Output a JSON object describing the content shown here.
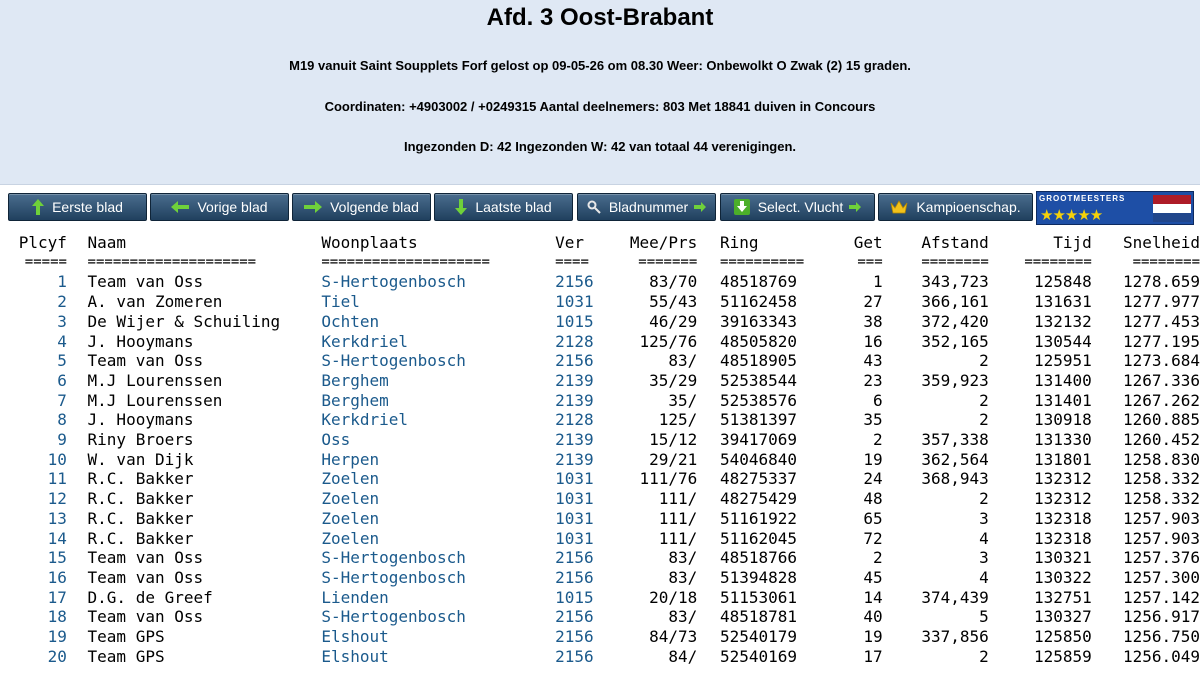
{
  "header": {
    "title": "Afd. 3 Oost-Brabant",
    "line1": "M19 vanuit Saint Soupplets Forf gelost op 09-05-26 om 08.30 Weer: Onbewolkt O Zwak (2) 15 graden.",
    "line2": "Coordinaten: +4903002 / +0249315 Aantal deelnemers: 803 Met 18841 duiven in Concours",
    "line3": "Ingezonden D: 42 Ingezonden W: 42 van totaal 44 verenigingen."
  },
  "toolbar": {
    "first": "Eerste blad",
    "prev": "Vorige blad",
    "next": "Volgende blad",
    "last": "Laatste blad",
    "page_number": "Bladnummer",
    "select_flight": "Select. Vlucht",
    "championship": "Kampioenschap.",
    "logo_text": "GROOTMEESTERS",
    "logo_stars": "★★★★★"
  },
  "colors": {
    "header_bg": "#dfe8f4",
    "button_bg": "#2f5272",
    "link_blue": "#1b5a8c",
    "flag_red": "#ae1c28",
    "flag_white": "#ffffff",
    "flag_blue": "#21468b"
  },
  "table": {
    "headers": [
      "Plcyf",
      "Naam",
      "Woonplaats",
      "Ver",
      "Mee/Prs",
      "Ring",
      "Get",
      "Afstand",
      "Tijd",
      "Snelheid"
    ],
    "separators": [
      "=====",
      "====================",
      "====================",
      "====",
      "=======",
      "==========",
      "===",
      "========",
      "========",
      "========"
    ],
    "rows": [
      [
        "1",
        "Team van Oss",
        "S-Hertogenbosch",
        "2156",
        "83/70",
        "48518769",
        "1",
        "343,723",
        "125848",
        "1278.659"
      ],
      [
        "2",
        "A. van Zomeren",
        "Tiel",
        "1031",
        "55/43",
        "51162458",
        "27",
        "366,161",
        "131631",
        "1277.977"
      ],
      [
        "3",
        "De Wijer & Schuiling",
        "Ochten",
        "1015",
        "46/29",
        "39163343",
        "38",
        "372,420",
        "132132",
        "1277.453"
      ],
      [
        "4",
        "J. Hooymans",
        "Kerkdriel",
        "2128",
        "125/76",
        "48505820",
        "16",
        "352,165",
        "130544",
        "1277.195"
      ],
      [
        "5",
        "Team van Oss",
        "S-Hertogenbosch",
        "2156",
        "83/",
        "48518905",
        "43",
        "2",
        "125951",
        "1273.684"
      ],
      [
        "6",
        "M.J Lourenssen",
        "Berghem",
        "2139",
        "35/29",
        "52538544",
        "23",
        "359,923",
        "131400",
        "1267.336"
      ],
      [
        "7",
        "M.J Lourenssen",
        "Berghem",
        "2139",
        "35/",
        "52538576",
        "6",
        "2",
        "131401",
        "1267.262"
      ],
      [
        "8",
        "J. Hooymans",
        "Kerkdriel",
        "2128",
        "125/",
        "51381397",
        "35",
        "2",
        "130918",
        "1260.885"
      ],
      [
        "9",
        "Riny Broers",
        "Oss",
        "2139",
        "15/12",
        "39417069",
        "2",
        "357,338",
        "131330",
        "1260.452"
      ],
      [
        "10",
        "W. van Dijk",
        "Herpen",
        "2139",
        "29/21",
        "54046840",
        "19",
        "362,564",
        "131801",
        "1258.830"
      ],
      [
        "11",
        "R.C. Bakker",
        "Zoelen",
        "1031",
        "111/76",
        "48275337",
        "24",
        "368,943",
        "132312",
        "1258.332"
      ],
      [
        "12",
        "R.C. Bakker",
        "Zoelen",
        "1031",
        "111/",
        "48275429",
        "48",
        "2",
        "132312",
        "1258.332"
      ],
      [
        "13",
        "R.C. Bakker",
        "Zoelen",
        "1031",
        "111/",
        "51161922",
        "65",
        "3",
        "132318",
        "1257.903"
      ],
      [
        "14",
        "R.C. Bakker",
        "Zoelen",
        "1031",
        "111/",
        "51162045",
        "72",
        "4",
        "132318",
        "1257.903"
      ],
      [
        "15",
        "Team van Oss",
        "S-Hertogenbosch",
        "2156",
        "83/",
        "48518766",
        "2",
        "3",
        "130321",
        "1257.376"
      ],
      [
        "16",
        "Team van Oss",
        "S-Hertogenbosch",
        "2156",
        "83/",
        "51394828",
        "45",
        "4",
        "130322",
        "1257.300"
      ],
      [
        "17",
        "D.G. de Greef",
        "Lienden",
        "1015",
        "20/18",
        "51153061",
        "14",
        "374,439",
        "132751",
        "1257.142"
      ],
      [
        "18",
        "Team van Oss",
        "S-Hertogenbosch",
        "2156",
        "83/",
        "48518781",
        "40",
        "5",
        "130327",
        "1256.917"
      ],
      [
        "19",
        "Team GPS",
        "Elshout",
        "2156",
        "84/73",
        "52540179",
        "19",
        "337,856",
        "125850",
        "1256.750"
      ],
      [
        "20",
        "Team GPS",
        "Elshout",
        "2156",
        "84/",
        "52540169",
        "17",
        "2",
        "125859",
        "1256.049"
      ]
    ]
  }
}
